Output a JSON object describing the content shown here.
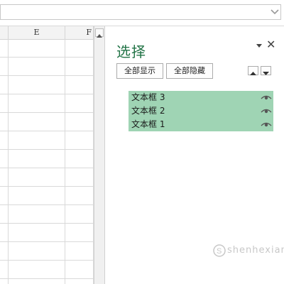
{
  "spreadsheet": {
    "columns": [
      "E",
      "F"
    ]
  },
  "selection_pane": {
    "title": "选择",
    "show_all_label": "全部显示",
    "hide_all_label": "全部隐藏",
    "items": [
      {
        "label": "文本框 3",
        "visible": true
      },
      {
        "label": "文本框 2",
        "visible": true
      },
      {
        "label": "文本框 1",
        "visible": true
      }
    ],
    "selected_color": "#9fd4b4",
    "title_color": "#217346"
  },
  "watermark": {
    "text": "shenhexian"
  }
}
